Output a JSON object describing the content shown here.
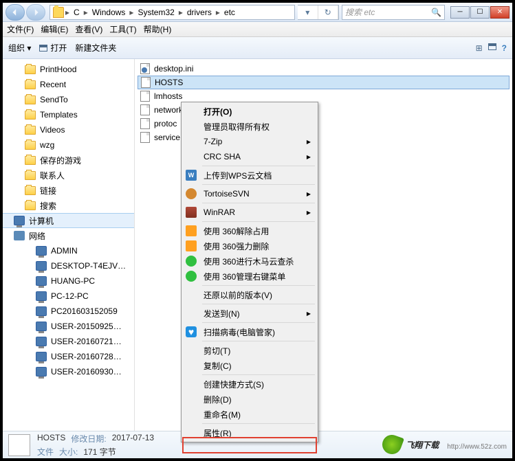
{
  "titlebar": {
    "win_min": "─",
    "win_max": "☐",
    "win_close": "✕"
  },
  "breadcrumb": {
    "sep": "▸",
    "items": [
      "C",
      "Windows",
      "System32",
      "drivers",
      "etc"
    ],
    "dropdown": "▾",
    "refresh": "↻"
  },
  "search": {
    "placeholder": "搜索 etc",
    "icon": "🔍"
  },
  "menubar": {
    "file": "文件(F)",
    "edit": "编辑(E)",
    "view": "查看(V)",
    "tools": "工具(T)",
    "help": "帮助(H)"
  },
  "toolbar": {
    "organize": "组织 ▾",
    "open": "打开",
    "new_folder": "新建文件夹",
    "view_icon": "⊞",
    "help_icon": "?"
  },
  "sidebar": {
    "items": [
      {
        "label": "PrintHood",
        "icon": "folder"
      },
      {
        "label": "Recent",
        "icon": "folder"
      },
      {
        "label": "SendTo",
        "icon": "folder"
      },
      {
        "label": "Templates",
        "icon": "folder"
      },
      {
        "label": "Videos",
        "icon": "folder"
      },
      {
        "label": "wzg",
        "icon": "folder"
      },
      {
        "label": "保存的游戏",
        "icon": "folder"
      },
      {
        "label": "联系人",
        "icon": "folder"
      },
      {
        "label": "链接",
        "icon": "folder"
      },
      {
        "label": "搜索",
        "icon": "folder"
      }
    ],
    "computer": "计算机",
    "network": "网络",
    "net_items": [
      "ADMIN",
      "DESKTOP-T4EJV…",
      "HUANG-PC",
      "PC-12-PC",
      "PC201603152059",
      "USER-20150925…",
      "USER-20160721…",
      "USER-20160728…",
      "USER-20160930…"
    ]
  },
  "files": [
    {
      "name": "desktop.ini",
      "type": "ini"
    },
    {
      "name": "HOSTS",
      "type": "file",
      "selected": true
    },
    {
      "name": "lmhosts",
      "type": "file"
    },
    {
      "name": "network",
      "type": "file"
    },
    {
      "name": "protoc",
      "type": "file"
    },
    {
      "name": "service",
      "type": "file"
    }
  ],
  "context_menu": {
    "open": "打开(O)",
    "admin": "管理员取得所有权",
    "zip7": "7-Zip",
    "crcsha": "CRC SHA",
    "wps": "上传到WPS云文档",
    "tsvn": "TortoiseSVN",
    "winrar": "WinRAR",
    "m360a": "使用 360解除占用",
    "m360b": "使用 360强力删除",
    "m360c": "使用 360进行木马云查杀",
    "m360d": "使用 360管理右键菜单",
    "prev_ver": "还原以前的版本(V)",
    "send_to": "发送到(N)",
    "qqscan": "扫描病毒(电脑管家)",
    "cut": "剪切(T)",
    "copy": "复制(C)",
    "shortcut": "创建快捷方式(S)",
    "delete": "删除(D)",
    "rename": "重命名(M)",
    "properties": "属性(R)"
  },
  "status": {
    "file": "HOSTS",
    "date_label": "修改日期:",
    "date_val": "2017-07-13",
    "type_label": "文件",
    "size_label": "大小:",
    "size_val": "171 字节"
  },
  "watermark": {
    "brand": "飞翔下载",
    "url": "http://www.52z.com"
  }
}
